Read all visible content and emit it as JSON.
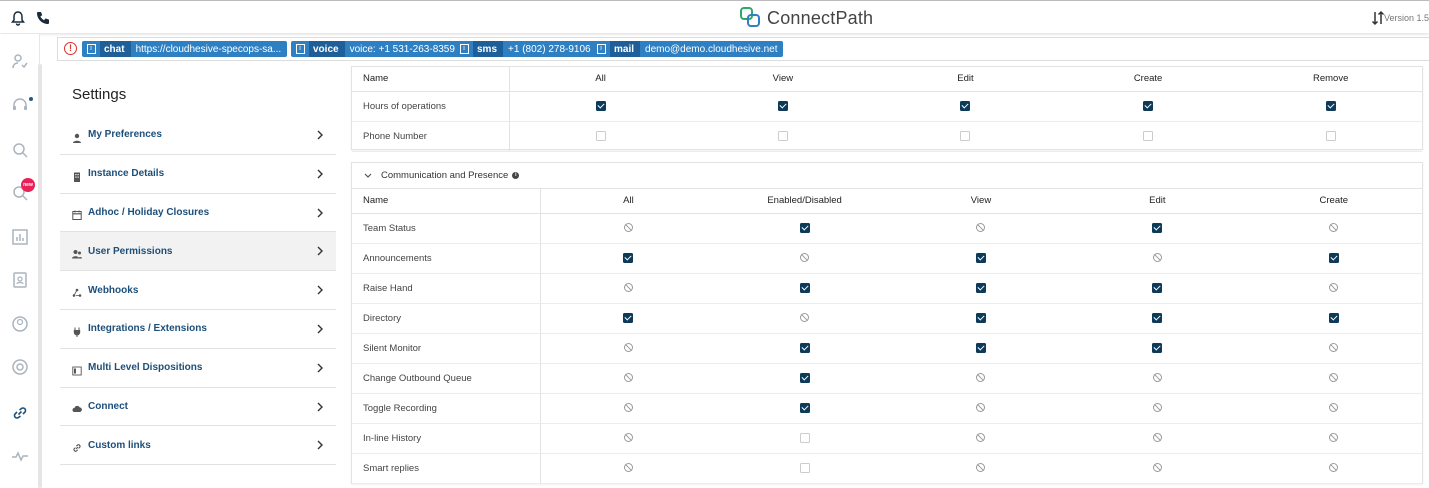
{
  "header": {
    "brand": "ConnectPath",
    "version": "Version 1.5",
    "icons": [
      "bell-icon",
      "phone-icon",
      "sort-icon"
    ]
  },
  "rail": {
    "icons": [
      "agent-icon",
      "headset-icon",
      "search-icon",
      "search-new-icon",
      "reports-icon",
      "contacts-icon",
      "profile-icon",
      "help-icon",
      "link-icon",
      "activity-icon"
    ],
    "badge": "new"
  },
  "channels": [
    {
      "tag": "chat",
      "value": "https://cloudhesive-specops-sa..."
    },
    {
      "tag": "voice",
      "value": "voice: +1 531-263-8359"
    },
    {
      "tag": "sms",
      "value": "+1 (802) 278-9106"
    },
    {
      "tag": "mail",
      "value": "demo@demo.cloudhesive.net"
    }
  ],
  "settings": {
    "title": "Settings",
    "items": [
      {
        "label": "My Preferences",
        "icon": "person-icon"
      },
      {
        "label": "Instance Details",
        "icon": "building-icon"
      },
      {
        "label": "Adhoc / Holiday Closures",
        "icon": "calendar-icon"
      },
      {
        "label": "User Permissions",
        "icon": "users-icon"
      },
      {
        "label": "Webhooks",
        "icon": "webhook-icon"
      },
      {
        "label": "Integrations / Extensions",
        "icon": "plug-icon"
      },
      {
        "label": "Multi Level Dispositions",
        "icon": "list-icon"
      },
      {
        "label": "Connect",
        "icon": "cloud-icon"
      },
      {
        "label": "Custom links",
        "icon": "link-icon"
      }
    ],
    "active_index": 3
  },
  "table1": {
    "columns": [
      "Name",
      "All",
      "View",
      "Edit",
      "Create",
      "Remove"
    ],
    "rows": [
      {
        "name": "Hours of operations",
        "cells": [
          "on",
          "on",
          "on",
          "on",
          "on"
        ]
      },
      {
        "name": "Phone Number",
        "cells": [
          "off",
          "off",
          "off",
          "off",
          "off"
        ]
      }
    ]
  },
  "table2": {
    "section_title": "Communication and Presence",
    "columns": [
      "Name",
      "All",
      "Enabled/Disabled",
      "View",
      "Edit",
      "Create"
    ],
    "rows": [
      {
        "name": "Team Status",
        "cells": [
          "na",
          "on",
          "na",
          "on",
          "na"
        ]
      },
      {
        "name": "Announcements",
        "cells": [
          "on",
          "na",
          "on",
          "na",
          "on"
        ]
      },
      {
        "name": "Raise Hand",
        "cells": [
          "na",
          "on",
          "on",
          "on",
          "na"
        ]
      },
      {
        "name": "Directory",
        "cells": [
          "on",
          "na",
          "on",
          "on",
          "on"
        ]
      },
      {
        "name": "Silent Monitor",
        "cells": [
          "na",
          "on",
          "on",
          "on",
          "na"
        ]
      },
      {
        "name": "Change Outbound Queue",
        "cells": [
          "na",
          "on",
          "na",
          "na",
          "na"
        ]
      },
      {
        "name": "Toggle Recording",
        "cells": [
          "na",
          "on",
          "na",
          "na",
          "na"
        ]
      },
      {
        "name": "In-line History",
        "cells": [
          "na",
          "off",
          "na",
          "na",
          "na"
        ]
      },
      {
        "name": "Smart replies",
        "cells": [
          "na",
          "off",
          "na",
          "na",
          "na"
        ]
      }
    ]
  },
  "colors": {
    "accent": "#0e3a5a",
    "chip": "#2f80c2",
    "chip_tag": "#1e5f99",
    "link_text": "#1d4f7a",
    "badge": "#e8215b",
    "alert": "#d9302c"
  }
}
